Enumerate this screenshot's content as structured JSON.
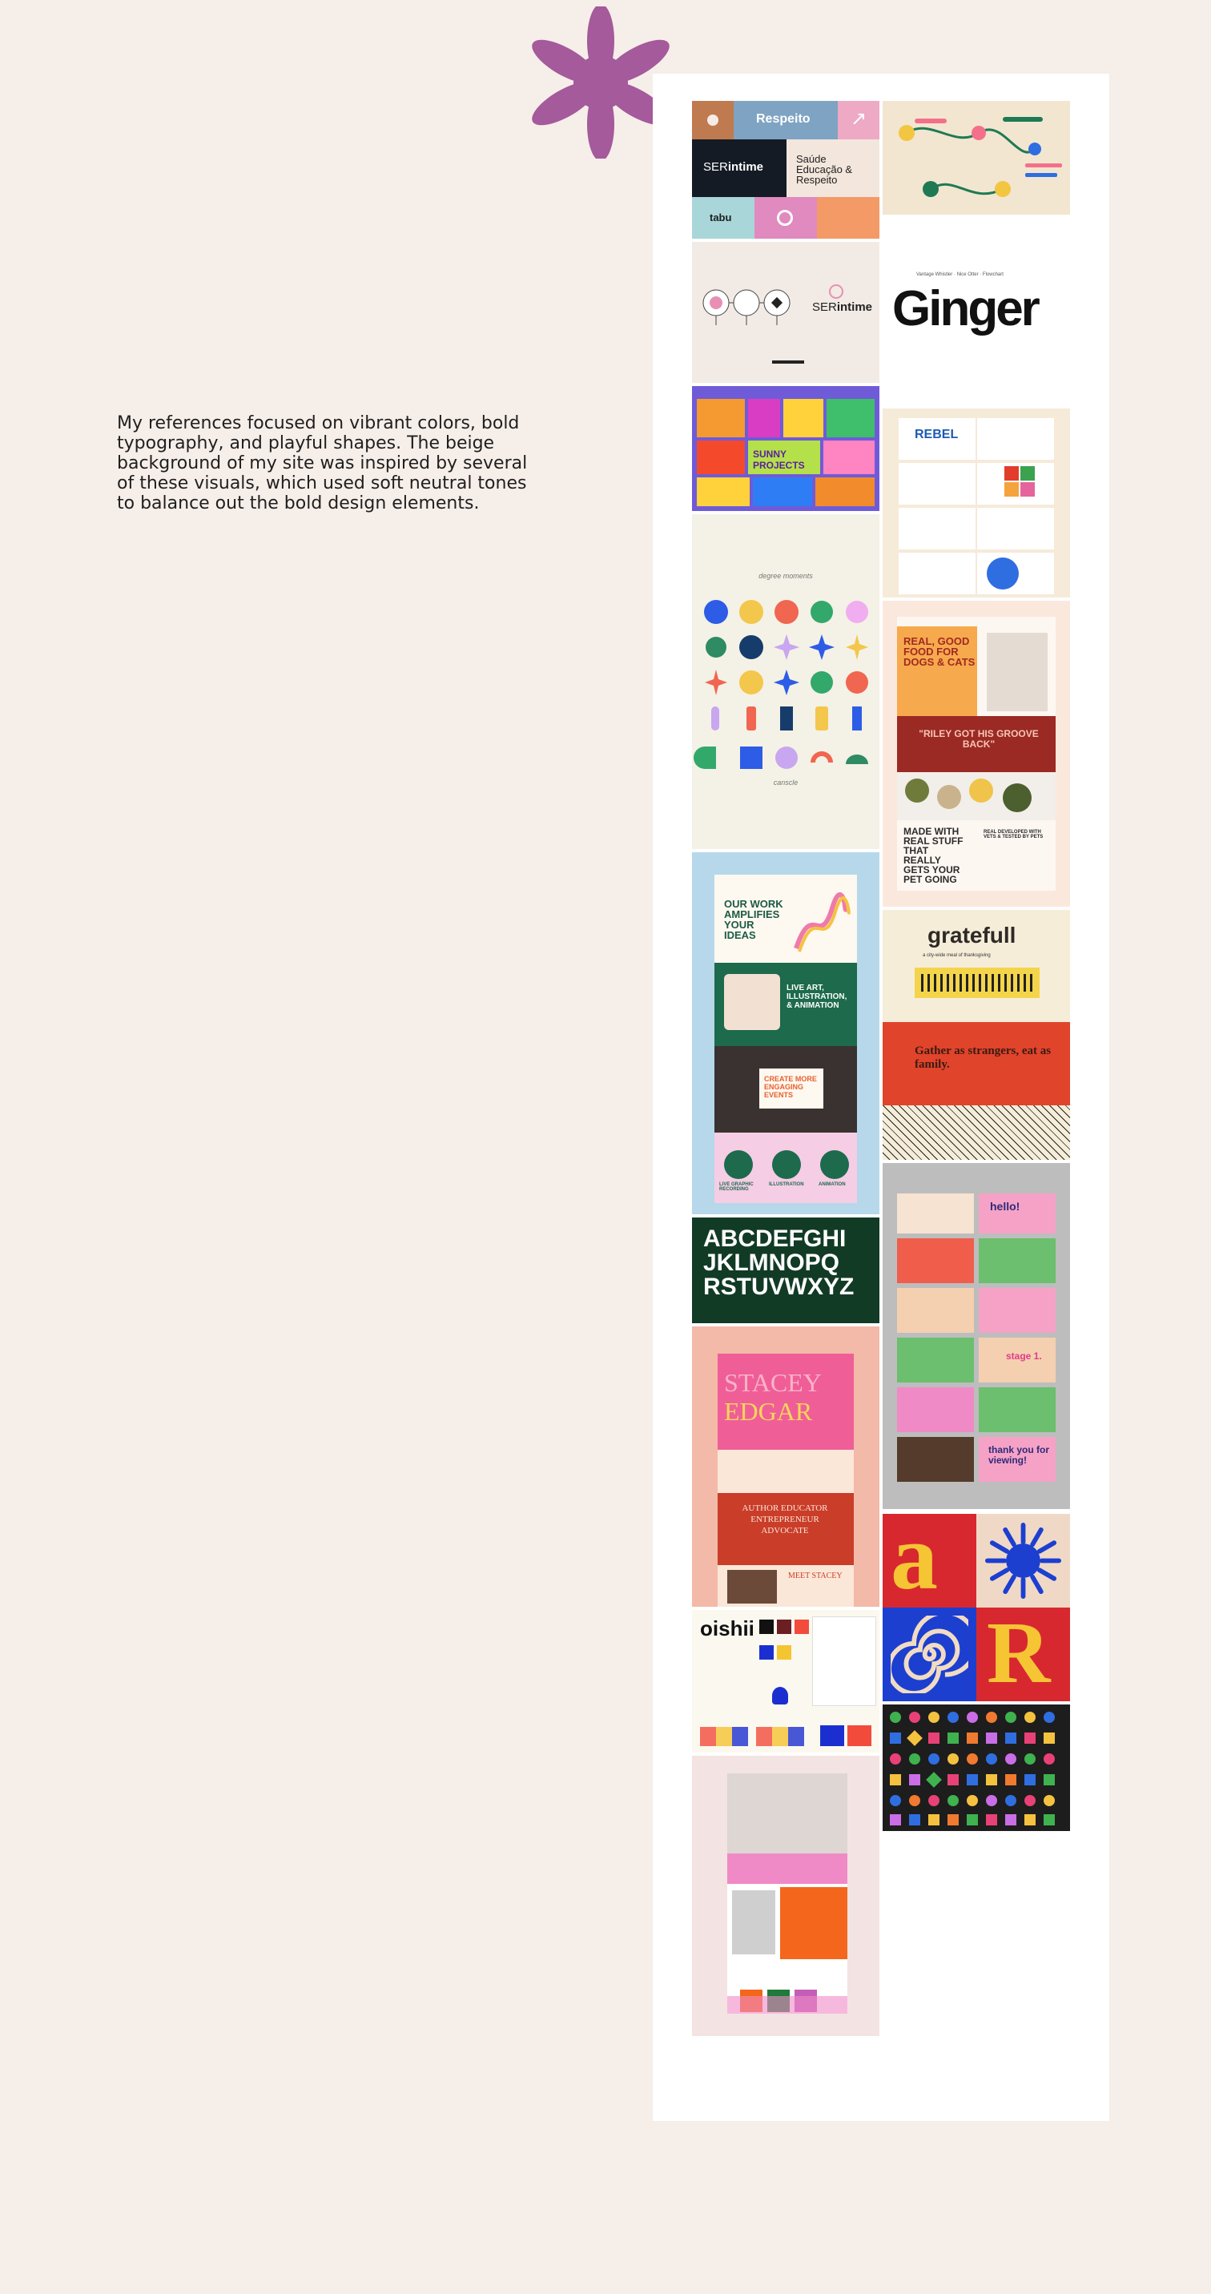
{
  "intro": {
    "text": "My references focused on vibrant colors, bold typography, and playful shapes. The beige background of my site was inspired by several of these visuals, which used soft neutral tones to balance out the bold design elements."
  },
  "decor": {
    "star_color": "#a45a9b"
  },
  "moodboard": {
    "serintime": {
      "respeito": "Respeito",
      "brand_a": "SER",
      "brand_b": "intime",
      "saude": "Saúde Educação & Respeito",
      "tabu": "tabu"
    },
    "ginger": {
      "caption": "Vantage Whistler · Nice Otter · Flowchart",
      "word": "Ginger"
    },
    "poster": {
      "headline": "SUNNY PROJECTS"
    },
    "shapes": {
      "top": "degree moments",
      "bottom": "canscle"
    },
    "rebel": {
      "word": "REBEL"
    },
    "dogfood": {
      "headline": "REAL, GOOD FOOD FOR DOGS & CATS",
      "quote": "\"RILEY GOT HIS GROOVE BACK\"",
      "made": "MADE WITH REAL STUFF THAT REALLY GETS YOUR PET GOING",
      "side": "REAL DEVELOPED WITH VETS & TESTED BY PETS"
    },
    "urban": {
      "top": "OUR WORK AMPLIFIES YOUR IDEAS",
      "mid": "LIVE ART, ILLUSTRATION, & ANIMATION",
      "events": "CREATE MORE ENGAGING EVENTS",
      "cap1": "LIVE GRAPHIC RECORDING",
      "cap2": "ILLUSTRATION",
      "cap3": "ANIMATION"
    },
    "gratefull": {
      "word": "gratefull",
      "tag": "a city-wide meal of thanksgiving",
      "quote": "Gather as strangers, eat as family."
    },
    "alphabet": {
      "line1": "ABCDEFGHI",
      "line2": "JKLMNOPQ",
      "line3": "RSTUVWXYZ"
    },
    "presentation": {
      "hello": "hello!",
      "thanks": "thank you for viewing!",
      "stage": "stage 1."
    },
    "stacey": {
      "name1": "STACEY",
      "name2": "EDGAR",
      "roles": "AUTHOR EDUCATOR ENTREPRENEUR ADVOCATE",
      "meet": "MEET STACEY"
    },
    "letters": {
      "a": "a",
      "r": "R"
    },
    "oishii": {
      "word": "oishii"
    }
  }
}
